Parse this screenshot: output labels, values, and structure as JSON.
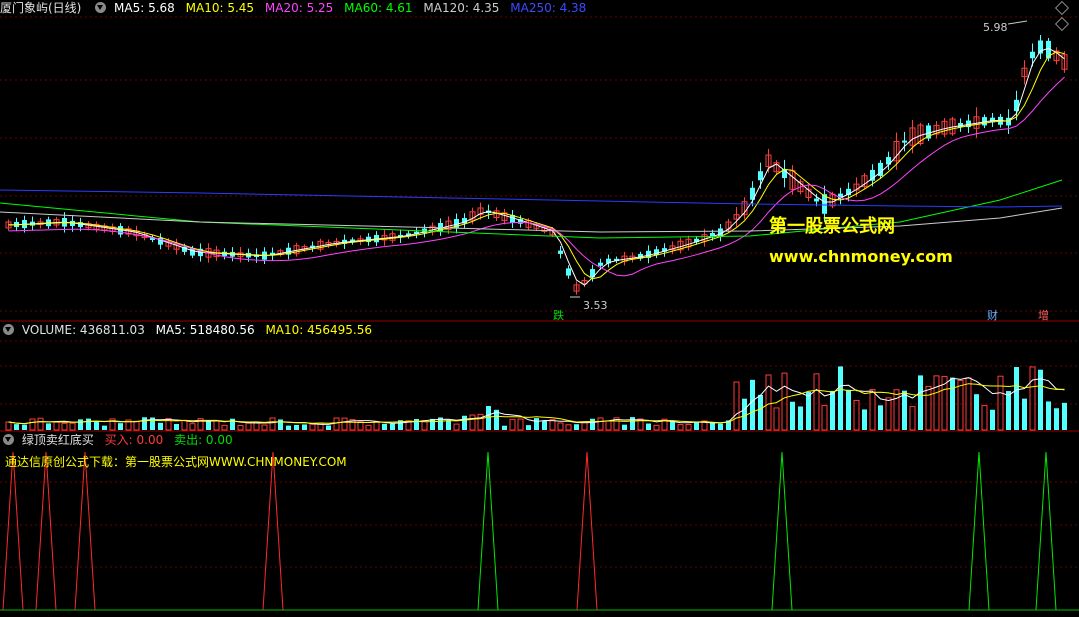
{
  "main_chart": {
    "stock_name": "厦门象屿(日线)",
    "ma_legend": [
      {
        "label": "MA5: 5.68",
        "color": "#ffffff"
      },
      {
        "label": "MA10: 5.45",
        "color": "#ffff00"
      },
      {
        "label": "MA20: 5.25",
        "color": "#ff44ff"
      },
      {
        "label": "MA60: 4.61",
        "color": "#00ff00"
      },
      {
        "label": "MA120: 4.35",
        "color": "#cccccc"
      },
      {
        "label": "MA250: 4.38",
        "color": "#2a3cff"
      }
    ],
    "high_label": "5.98",
    "low_label": "3.53",
    "marker_die": "跌",
    "marker_cai": "财",
    "marker_zeng": "增"
  },
  "volume_panel": {
    "title": "VOLUME: 436811.03",
    "ma5": "MA5: 518480.56",
    "ma10": "MA10: 456495.56"
  },
  "indicator_panel": {
    "title": "绿顶卖红底买",
    "buy": "买入: 0.00",
    "sell": "卖出: 0.00",
    "note": "通达信原创公式下载：第一股票公式网WWW.CHNMONEY.COM"
  },
  "watermark": {
    "line1": "第一股票公式网",
    "line2": "www.chnmoney.com"
  },
  "colors": {
    "up": "#ff3c3c",
    "down": "#54ffff",
    "grid": "#6a0000",
    "buy_signal": "#ff2a2a",
    "sell_signal": "#00e800"
  }
}
